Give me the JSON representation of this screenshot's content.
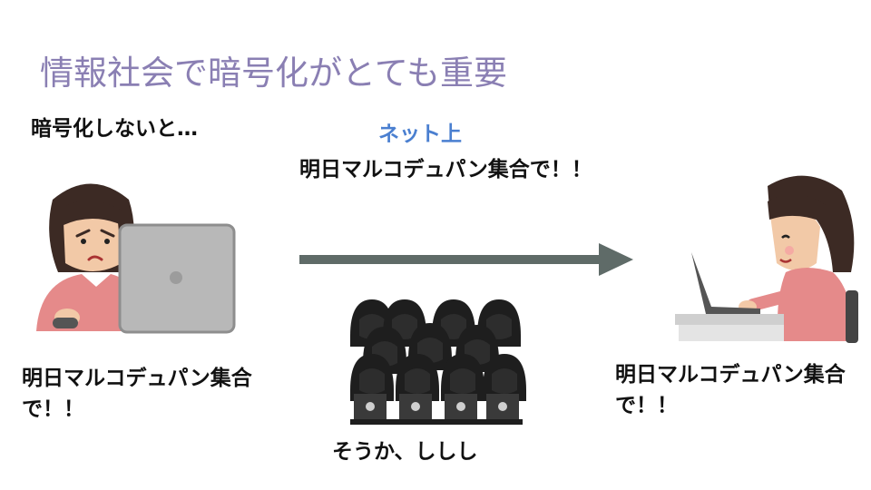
{
  "slide": {
    "title": "情報社会で暗号化がとても重要",
    "subtitle": "暗号化しないと…",
    "network_label": "ネット上",
    "message_in_transit": "明日マルコデュパン集合で！！",
    "sender_message": "明日マルコデュパン集合で！！",
    "receiver_message": "明日マルコデュパン集合で！！",
    "eavesdropper_reply": "そうか、ししし"
  },
  "colors": {
    "title": "#8a7fb3",
    "network_label": "#4a7fd0",
    "arrow": "#5f6b68"
  },
  "icons": {
    "sender": "worried-woman-laptop-illustration",
    "receiver": "smiling-woman-laptop-illustration",
    "eavesdroppers": "hooded-hackers-group-illustration"
  }
}
